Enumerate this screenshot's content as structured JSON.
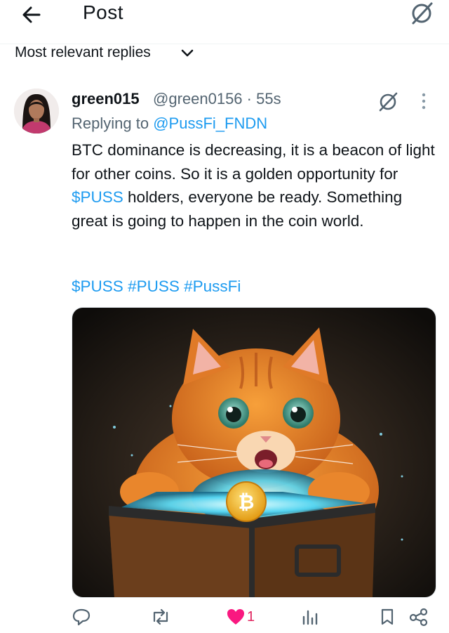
{
  "header": {
    "title": "Post"
  },
  "replies": {
    "sort_label": "Most relevant replies"
  },
  "post": {
    "display_name": "green015",
    "handle": "@green0156",
    "time": "55s",
    "separator": " · ",
    "replying_prefix": "Replying to",
    "replying_to": "@PussFi_FNDN",
    "body": {
      "part1": "BTC dominance is decreasing, it is a beacon of light for other coins. So it is a golden opportunity for ",
      "cashtag": "$PUSS",
      "part2": " holders, everyone be ready. Something great is going to happen in the coin world."
    },
    "hashtags": [
      "$PUSS",
      "#PUSS",
      "#PussFi"
    ],
    "media": {
      "coin_symbol": "₿"
    },
    "actions": {
      "likes": "1"
    }
  },
  "colors": {
    "accent": "#1d9bf0",
    "like": "#f91880",
    "muted": "#536471"
  }
}
